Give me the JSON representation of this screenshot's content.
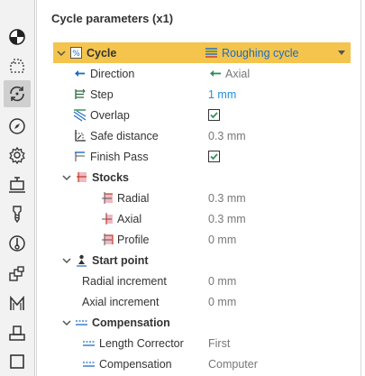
{
  "panel": {
    "title": "Cycle parameters (x1)"
  },
  "toolbar": {
    "tools": [
      {
        "name": "material-icon"
      },
      {
        "name": "selection-icon"
      },
      {
        "name": "cycle-icon"
      },
      {
        "name": "compass-icon"
      },
      {
        "name": "settings-gear-icon"
      },
      {
        "name": "machine-icon"
      },
      {
        "name": "drill-tool-icon"
      },
      {
        "name": "probe-icon"
      },
      {
        "name": "stack-icon"
      },
      {
        "name": "macro-m-icon"
      },
      {
        "name": "stamp-icon"
      },
      {
        "name": "square-icon"
      }
    ]
  },
  "rows": {
    "cycle": {
      "label": "Cycle",
      "value": "Roughing cycle"
    },
    "direction": {
      "label": "Direction",
      "value": "Axial"
    },
    "step": {
      "label": "Step",
      "value": "1 mm"
    },
    "overlap": {
      "label": "Overlap",
      "checked": true
    },
    "safe_distance": {
      "label": "Safe distance",
      "value": "0.3 mm"
    },
    "finish_pass": {
      "label": "Finish Pass",
      "checked": true
    },
    "stocks": {
      "label": "Stocks"
    },
    "radial": {
      "label": "Radial",
      "value": "0.3 mm"
    },
    "axial": {
      "label": "Axial",
      "value": "0.3 mm"
    },
    "profile": {
      "label": "Profile",
      "value": "0 mm"
    },
    "start_point": {
      "label": "Start point"
    },
    "radial_increment": {
      "label": "Radial increment",
      "value": "0 mm"
    },
    "axial_increment": {
      "label": "Axial increment",
      "value": "0 mm"
    },
    "compensation_group": {
      "label": "Compensation"
    },
    "length_corrector": {
      "label": "Length Corrector",
      "value": "First"
    },
    "compensation": {
      "label": "Compensation",
      "value": "Computer"
    }
  },
  "colors": {
    "highlight": "#f4c44d",
    "link_blue": "#1b6cc2",
    "value_blue": "#1f8fd8",
    "value_gray": "#777777"
  }
}
